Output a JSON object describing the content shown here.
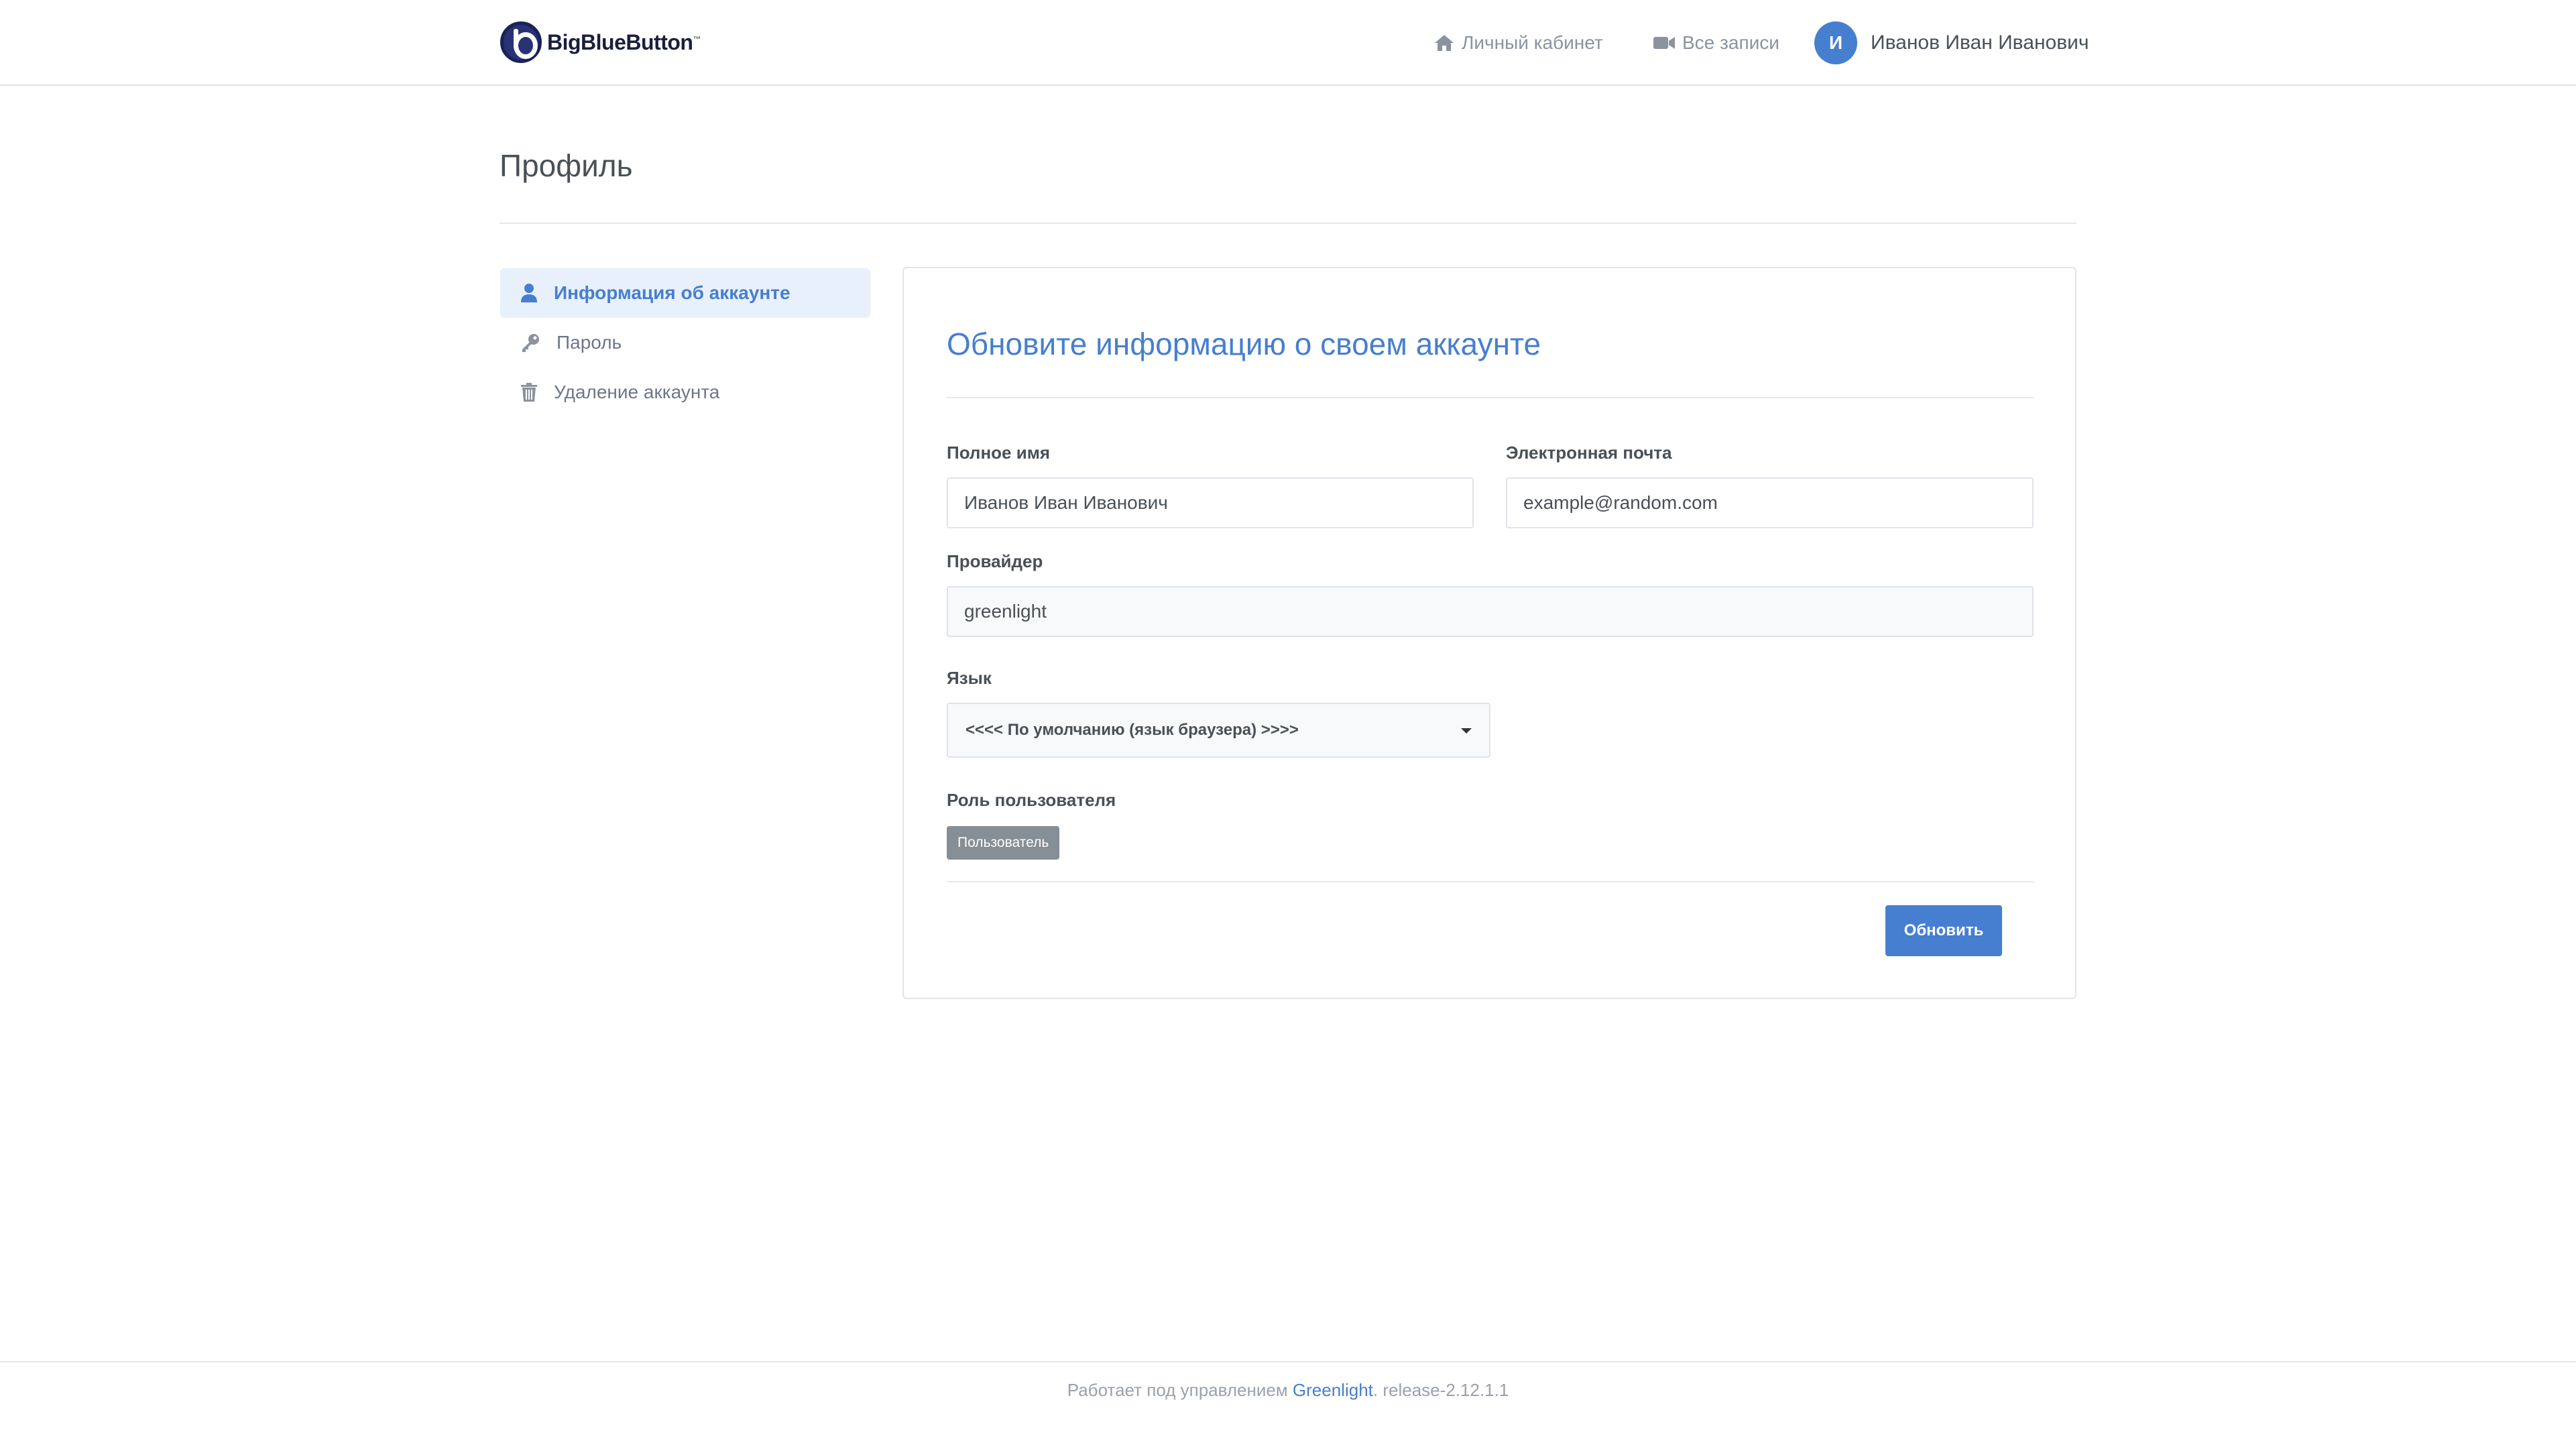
{
  "header": {
    "logo_text": "BigBlueButton",
    "logo_tm": "™",
    "nav_home": "Личный кабинет",
    "nav_recordings": "Все записи",
    "avatar_initial": "И",
    "user_name": "Иванов Иван Иванович"
  },
  "page": {
    "title": "Профиль"
  },
  "sidebar": {
    "items": [
      {
        "label": "Информация об аккаунте",
        "icon": "user-icon",
        "active": true
      },
      {
        "label": "Пароль",
        "icon": "key-icon",
        "active": false
      },
      {
        "label": "Удаление аккаунта",
        "icon": "trash-icon",
        "active": false
      }
    ]
  },
  "form": {
    "title": "Обновите информацию о своем аккаунте",
    "full_name_label": "Полное имя",
    "full_name_value": "Иванов Иван Иванович",
    "email_label": "Электронная почта",
    "email_value": "example@random.com",
    "provider_label": "Провайдер",
    "provider_value": "greenlight",
    "language_label": "Язык",
    "language_value": "<<<< По умолчанию (язык браузера) >>>>",
    "role_label": "Роль пользователя",
    "role_value": "Пользователь",
    "submit_label": "Обновить"
  },
  "footer": {
    "prefix": "Работает под управлением",
    "link": "Greenlight",
    "suffix": ". release-2.12.1.1"
  },
  "colors": {
    "accent": "#467fcf",
    "badge": "#868e96",
    "active_bg": "#e8f0fb"
  }
}
